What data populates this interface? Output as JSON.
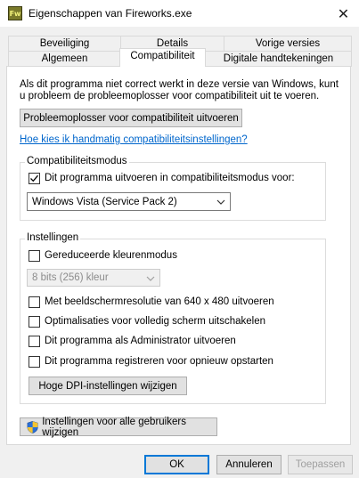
{
  "window": {
    "title": "Eigenschappen van Fireworks.exe",
    "app_icon_text": "Fw",
    "close_glyph": "✕"
  },
  "tabs": {
    "row1": [
      {
        "label": "Beveiliging"
      },
      {
        "label": "Details"
      },
      {
        "label": "Vorige versies"
      }
    ],
    "row2": [
      {
        "label": "Algemeen"
      },
      {
        "label": "Compatibiliteit",
        "active": true
      },
      {
        "label": "Digitale handtekeningen"
      }
    ]
  },
  "panel": {
    "intro_line1": "Als dit programma niet correct werkt in deze versie van Windows, kunt",
    "intro_line2": "u probleem de probleemoplosser voor compatibiliteit uit te voeren.",
    "troubleshooter_button": "Probleemoplosser voor compatibiliteit uitvoeren",
    "manual_link": "Hoe kies ik handmatig compatibiliteitsinstellingen?",
    "compat_mode": {
      "group_label": "Compatibiliteitsmodus",
      "checkbox_label": "Dit programma uitvoeren in compatibiliteitsmodus voor:",
      "checked": true,
      "selected_os": "Windows Vista (Service Pack 2)"
    },
    "settings": {
      "group_label": "Instellingen",
      "reduced_color": {
        "label": "Gereduceerde kleurenmodus",
        "checked": false
      },
      "color_select": "8 bits (256) kleur",
      "options": [
        {
          "label": "Met beeldschermresolutie van 640 x 480 uitvoeren",
          "checked": false
        },
        {
          "label": "Optimalisaties voor volledig scherm uitschakelen",
          "checked": false
        },
        {
          "label": "Dit programma als Administrator uitvoeren",
          "checked": false
        },
        {
          "label": "Dit programma registreren voor opnieuw opstarten",
          "checked": false
        }
      ],
      "dpi_button": "Hoge DPI-instellingen wijzigen"
    },
    "all_users_button": "Instellingen voor alle gebruikers wijzigen"
  },
  "footer": {
    "ok": "OK",
    "cancel": "Annuleren",
    "apply": "Toepassen"
  },
  "colors": {
    "link": "#0066cc",
    "primary_border": "#0078d7",
    "dialog_bg": "#f0f0f0"
  }
}
